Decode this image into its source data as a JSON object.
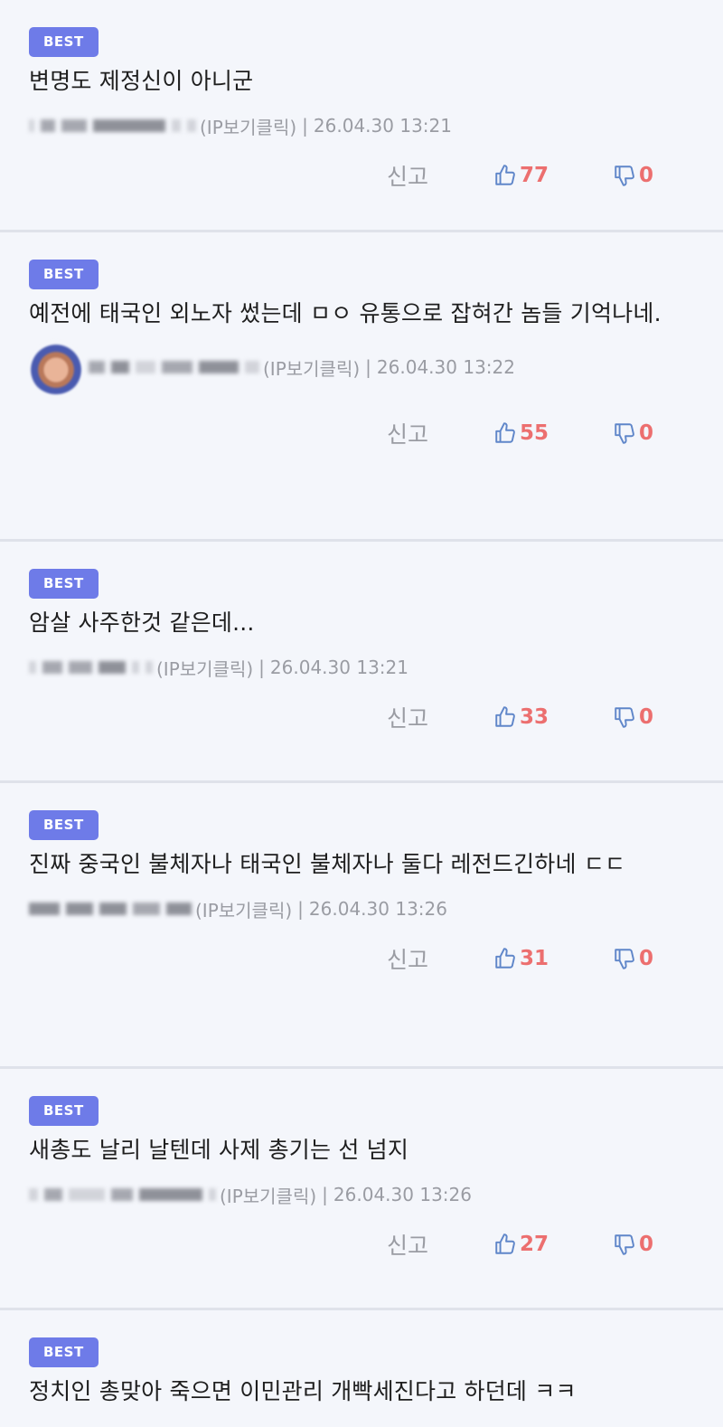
{
  "colors": {
    "badge": "#6e7be8",
    "vote_count": "#ec6f6f",
    "thumb_icon": "#5f86c9",
    "meta_text": "#9a9ca3",
    "background": "#f4f6fb"
  },
  "icons": {
    "like": "thumbs-up-icon",
    "dislike": "thumbs-down-icon"
  },
  "comments": [
    {
      "badge": "BEST",
      "text": "변명도 제정신이 아니군",
      "has_avatar": false,
      "ip_label": "(IP보기클릭)",
      "separator": "|",
      "timestamp": "26.04.30 13:21",
      "report_label": "신고",
      "likes": "77",
      "dislikes": "0"
    },
    {
      "badge": "BEST",
      "text": "예전에 태국인 외노자 썼는데 ㅁㅇ 유통으로 잡혀간 놈들 기억나네.",
      "has_avatar": true,
      "ip_label": "(IP보기클릭)",
      "separator": "|",
      "timestamp": "26.04.30 13:22",
      "report_label": "신고",
      "likes": "55",
      "dislikes": "0"
    },
    {
      "badge": "BEST",
      "text": "암살 사주한것 같은데...",
      "has_avatar": false,
      "ip_label": "(IP보기클릭)",
      "separator": "|",
      "timestamp": "26.04.30 13:21",
      "report_label": "신고",
      "likes": "33",
      "dislikes": "0"
    },
    {
      "badge": "BEST",
      "text": "진짜 중국인 불체자나 태국인 불체자나 둘다 레전드긴하네 ㄷㄷ",
      "has_avatar": false,
      "ip_label": "(IP보기클릭)",
      "separator": "|",
      "timestamp": "26.04.30 13:26",
      "report_label": "신고",
      "likes": "31",
      "dislikes": "0"
    },
    {
      "badge": "BEST",
      "text": "새총도 날리 날텐데 사제 총기는 선 넘지",
      "has_avatar": false,
      "ip_label": "(IP보기클릭)",
      "separator": "|",
      "timestamp": "26.04.30 13:26",
      "report_label": "신고",
      "likes": "27",
      "dislikes": "0"
    },
    {
      "badge": "BEST",
      "text": "정치인 총맞아 죽으면 이민관리 개빡세진다고 하던데 ㅋㅋ"
    }
  ]
}
